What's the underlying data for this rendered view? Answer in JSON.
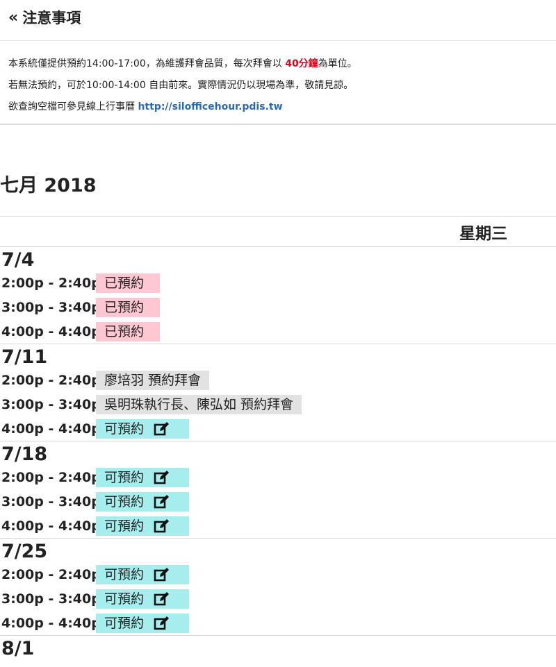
{
  "notice": {
    "chevron": "«",
    "title": "注意事項",
    "line1_pre": "本系統僅提供預約14:00-17:00，為維護拜會品質，每次拜會以 ",
    "line1_red": "40分鐘",
    "line1_post": "為單位。",
    "line2": "若無法預約，可於10:00-14:00 自由前來。實際情況仍以現場為準，敬請見諒。",
    "line3_pre": "欲查詢空檔可參見線上行事曆 ",
    "line3_link": "http://silofficehour.pdis.tw"
  },
  "calendar": {
    "month_title": "七月 2018",
    "weekday": "星期三",
    "days": [
      {
        "date": "7/4",
        "slots": [
          {
            "time": "2:00p - 2:40p",
            "label": "已預約"
          },
          {
            "time": "3:00p - 3:40p",
            "label": "已預約"
          },
          {
            "time": "4:00p - 4:40p",
            "label": "已預約"
          }
        ]
      },
      {
        "date": "7/11",
        "slots": [
          {
            "time": "2:00p - 2:40p",
            "label": "廖培羽 預約拜會"
          },
          {
            "time": "3:00p - 3:40p",
            "label": "吳明珠執行長、陳弘如 預約拜會"
          },
          {
            "time": "4:00p - 4:40p",
            "label": "可預約"
          }
        ]
      },
      {
        "date": "7/18",
        "slots": [
          {
            "time": "2:00p - 2:40p",
            "label": "可預約"
          },
          {
            "time": "3:00p - 3:40p",
            "label": "可預約"
          },
          {
            "time": "4:00p - 4:40p",
            "label": "可預約"
          }
        ]
      },
      {
        "date": "7/25",
        "slots": [
          {
            "time": "2:00p - 2:40p",
            "label": "可預約"
          },
          {
            "time": "3:00p - 3:40p",
            "label": "可預約"
          },
          {
            "time": "4:00p - 4:40p",
            "label": "可預約"
          }
        ]
      },
      {
        "date": "8/1",
        "slots": []
      }
    ]
  },
  "colors": {
    "booked": "#ffc7d1",
    "occupied": "#e2e2e2",
    "open": "#a6eeee",
    "accent_red": "#e0001b",
    "link": "#2a6ab1"
  },
  "icons": {
    "edit": "edit-icon"
  }
}
